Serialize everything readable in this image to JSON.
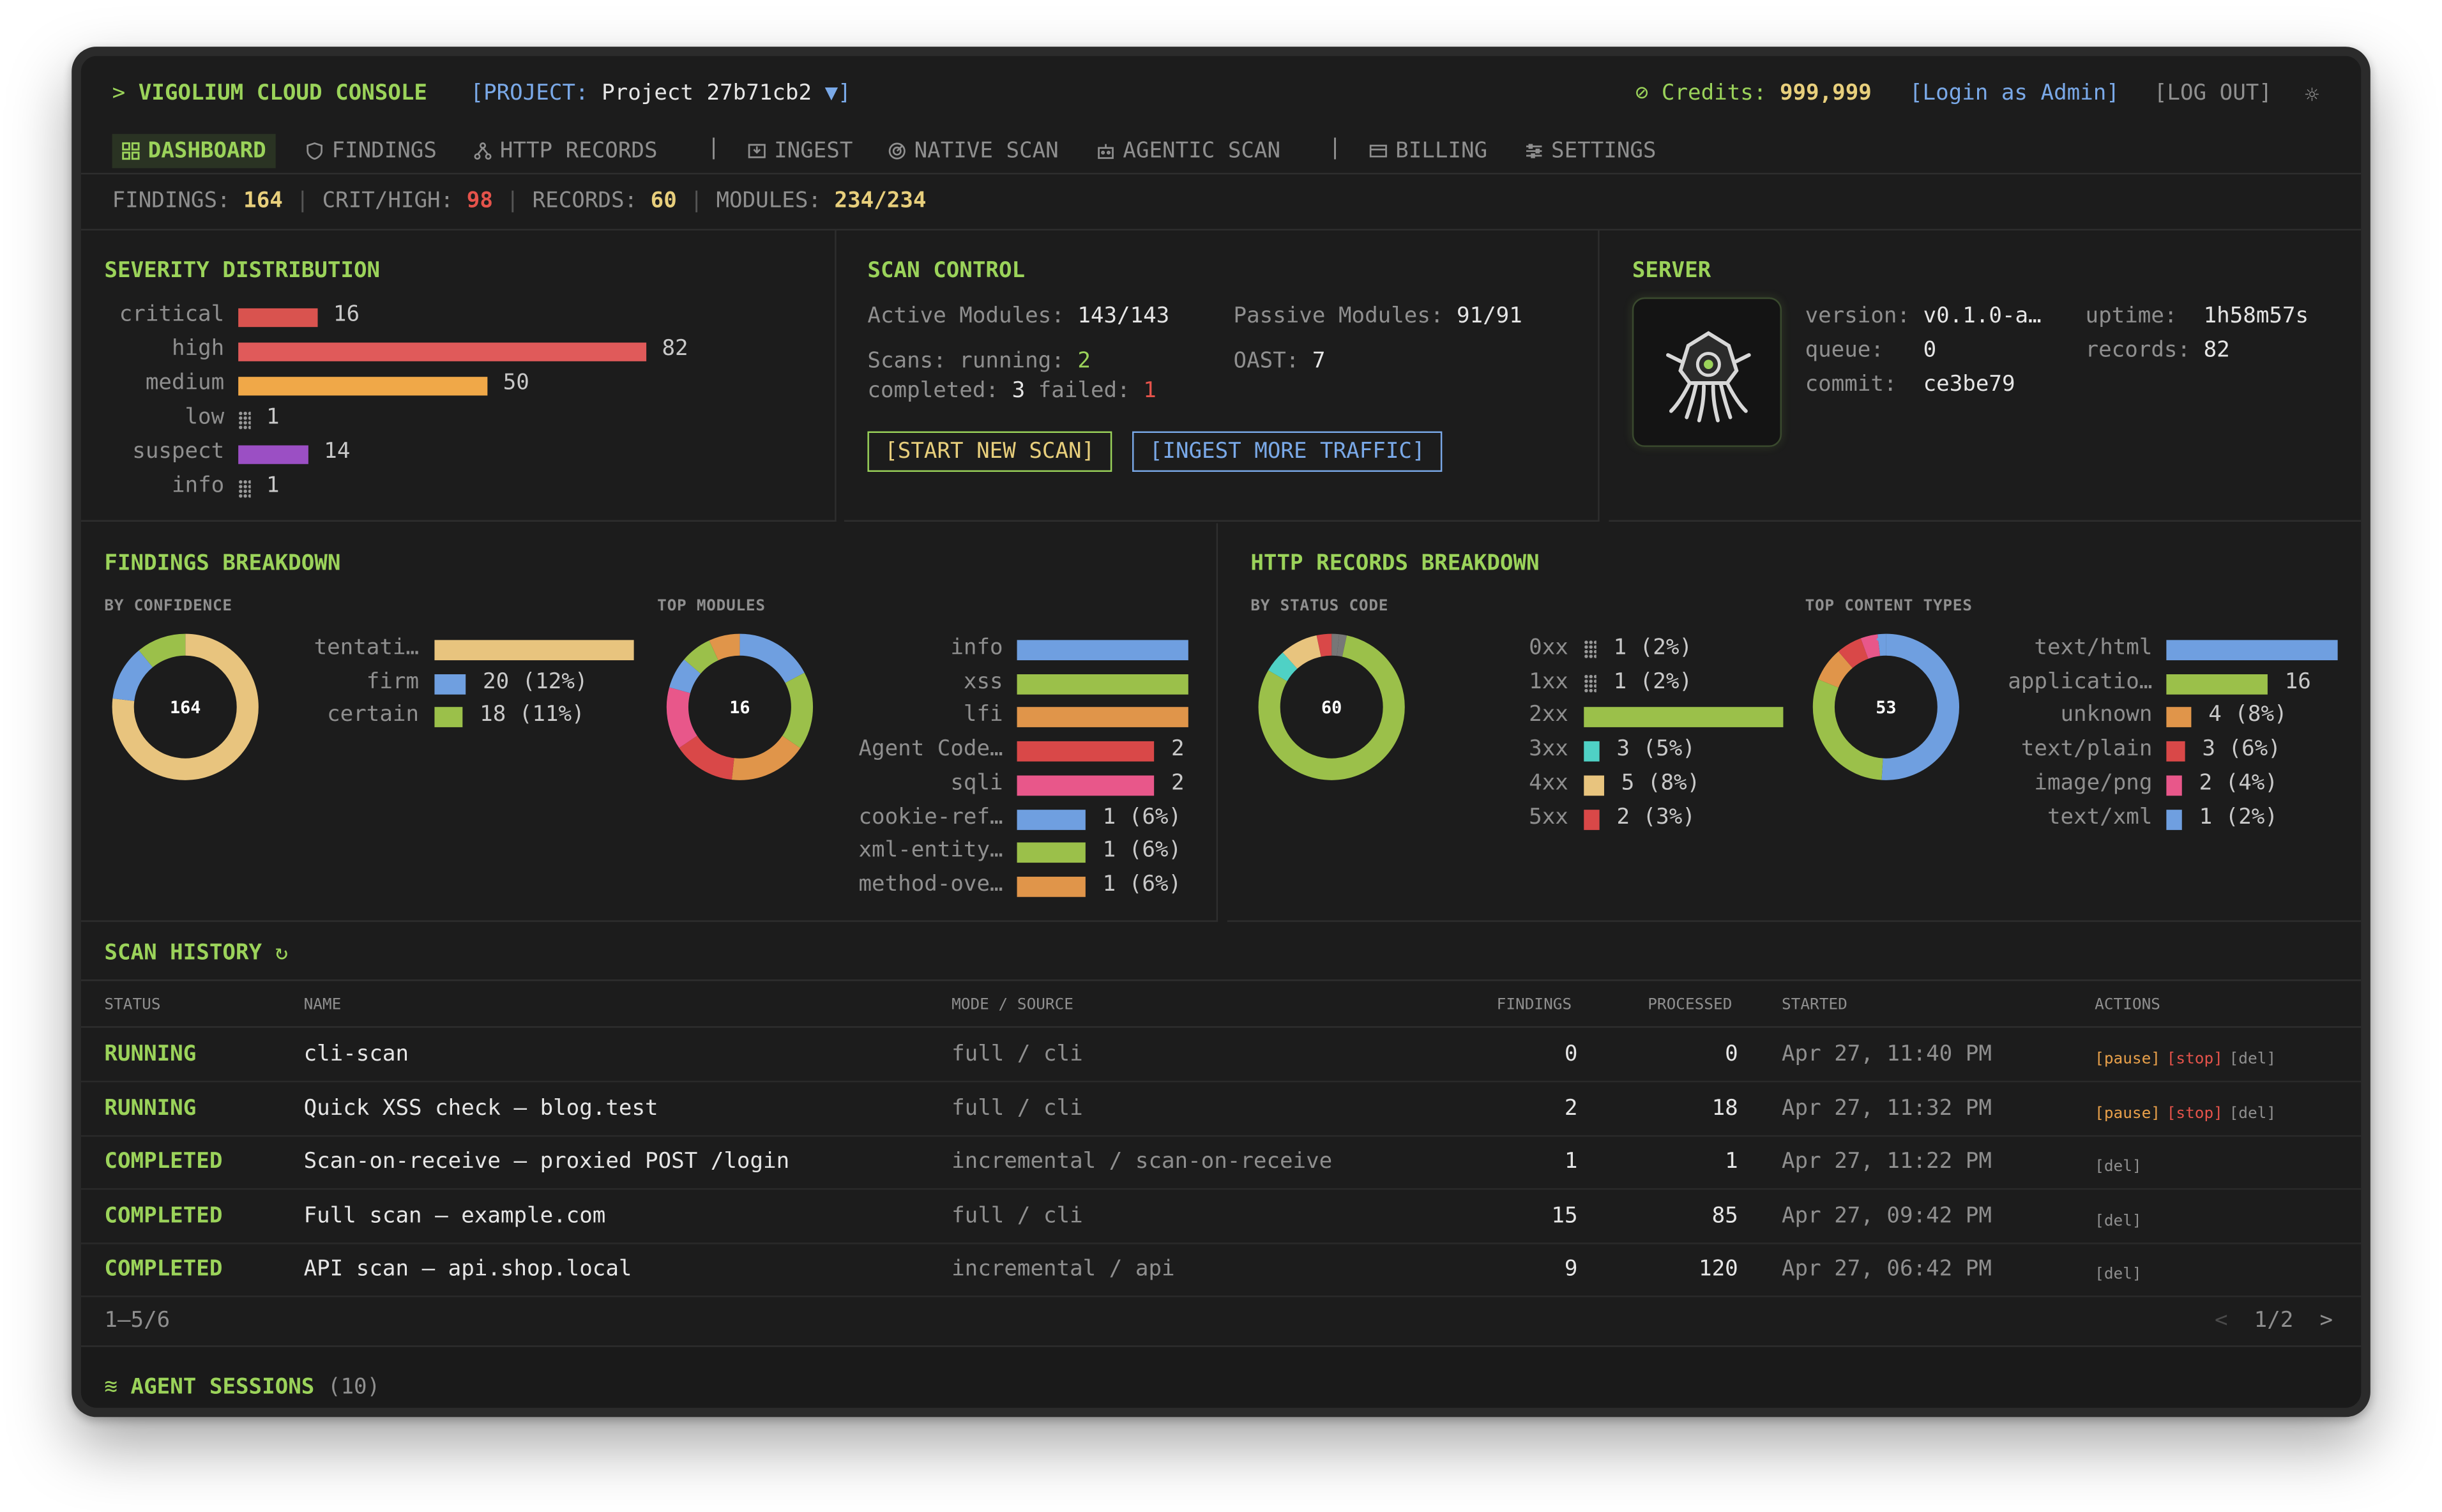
{
  "app": {
    "prompt": ">",
    "title": "VIGOLIUM CLOUD CONSOLE",
    "project_label": "[PROJECT:",
    "project_name": "Project 27b71cb2",
    "project_caret": "▼]",
    "credits_label": "Credits:",
    "credits_value": "999,999",
    "login": "[Login as Admin]",
    "logout": "[LOG OUT]"
  },
  "nav": {
    "dashboard": "DASHBOARD",
    "findings": "FINDINGS",
    "http_records": "HTTP RECORDS",
    "ingest": "INGEST",
    "native_scan": "NATIVE SCAN",
    "agentic_scan": "AGENTIC SCAN",
    "billing": "BILLING",
    "settings": "SETTINGS"
  },
  "stats": {
    "findings_label": "FINDINGS:",
    "findings": "164",
    "crit_label": "CRIT/HIGH:",
    "crit": "98",
    "records_label": "RECORDS:",
    "records": "60",
    "modules_label": "MODULES:",
    "modules": "234/234",
    "sep": "|"
  },
  "severity": {
    "title": "SEVERITY DISTRIBUTION",
    "max": 82,
    "rows": [
      {
        "label": "critical",
        "value": 16,
        "color": "#d9534f"
      },
      {
        "label": "high",
        "value": 82,
        "color": "#e05a5a"
      },
      {
        "label": "medium",
        "value": 50,
        "color": "#f0a848"
      },
      {
        "label": "low",
        "value": 1,
        "color": "dots"
      },
      {
        "label": "suspect",
        "value": 14,
        "color": "#9b4fc4"
      },
      {
        "label": "info",
        "value": 1,
        "color": "dots"
      }
    ]
  },
  "scan_control": {
    "title": "SCAN CONTROL",
    "active_label": "Active Modules:",
    "active": "143/143",
    "passive_label": "Passive Modules:",
    "passive": "91/91",
    "scans_label": "Scans: running:",
    "running": "2",
    "oast_label": "OAST:",
    "oast": "7",
    "completed_label": "completed:",
    "completed": "3",
    "failed_label": "failed:",
    "failed": "1",
    "start_btn": "[START NEW SCAN]",
    "ingest_btn": "[INGEST MORE TRAFFIC]"
  },
  "server": {
    "title": "SERVER",
    "version_label": "version:",
    "version": "v0.1.0-a…",
    "queue_label": "queue:",
    "queue": "0",
    "commit_label": "commit:",
    "commit": "ce3be79",
    "uptime_label": "uptime:",
    "uptime": "1h58m57s",
    "records_label": "records:",
    "records": "82"
  },
  "findings_breakdown": {
    "title": "FINDINGS BREAKDOWN",
    "by_conf": "BY CONFIDENCE",
    "top_modules": "TOP MODULES",
    "confidence": {
      "total": "164",
      "rows": [
        {
          "label": "tentati…",
          "value": 126,
          "text": "",
          "color": "#e8c47e"
        },
        {
          "label": "firm",
          "value": 20,
          "text": "20 (12%)",
          "color": "#6f9fe0"
        },
        {
          "label": "certain",
          "value": 18,
          "text": "18 (11%)",
          "color": "#9bc04a"
        }
      ]
    },
    "modules": {
      "total": "16",
      "rows": [
        {
          "label": "info",
          "value": 5,
          "text": "",
          "color": "#6f9fe0"
        },
        {
          "label": "xss",
          "value": 5,
          "text": "",
          "color": "#9bc04a"
        },
        {
          "label": "lfi",
          "value": 5,
          "text": "",
          "color": "#e0954a"
        },
        {
          "label": "Agent Code…",
          "value": 4,
          "text": "2",
          "color": "#d94848"
        },
        {
          "label": "sqli",
          "value": 4,
          "text": "2",
          "color": "#e8578a"
        },
        {
          "label": "cookie-ref…",
          "value": 2,
          "text": "1 (6%)",
          "color": "#6f9fe0"
        },
        {
          "label": "xml-entity…",
          "value": 2,
          "text": "1 (6%)",
          "color": "#9bc04a"
        },
        {
          "label": "method-ove…",
          "value": 2,
          "text": "1 (6%)",
          "color": "#e0954a"
        }
      ]
    }
  },
  "http_breakdown": {
    "title": "HTTP RECORDS BREAKDOWN",
    "by_status": "BY STATUS CODE",
    "top_types": "TOP CONTENT TYPES",
    "status": {
      "total": "60",
      "rows": [
        {
          "label": "0xx",
          "value": 1,
          "text": "1 (2%)",
          "color": "dots"
        },
        {
          "label": "1xx",
          "value": 1,
          "text": "1 (2%)",
          "color": "dots"
        },
        {
          "label": "2xx",
          "value": 48,
          "text": "",
          "color": "#9bc04a"
        },
        {
          "label": "3xx",
          "value": 3,
          "text": "3 (5%)",
          "color": "#4fd1c5"
        },
        {
          "label": "4xx",
          "value": 5,
          "text": "5 (8%)",
          "color": "#e8c47e"
        },
        {
          "label": "5xx",
          "value": 2,
          "text": "2 (3%)",
          "color": "#d94848"
        }
      ]
    },
    "types": {
      "total": "53",
      "rows": [
        {
          "label": "text/html",
          "value": 27,
          "text": "",
          "color": "#6f9fe0"
        },
        {
          "label": "applicatio…",
          "value": 16,
          "text": "16",
          "color": "#9bc04a"
        },
        {
          "label": "unknown",
          "value": 4,
          "text": "4 (8%)",
          "color": "#e0954a"
        },
        {
          "label": "text/plain",
          "value": 3,
          "text": "3 (6%)",
          "color": "#d94848"
        },
        {
          "label": "image/png",
          "value": 2,
          "text": "2 (4%)",
          "color": "#e8578a"
        },
        {
          "label": "text/xml",
          "value": 1,
          "text": "1 (2%)",
          "color": "#6f9fe0"
        }
      ]
    }
  },
  "history": {
    "title": "SCAN HISTORY",
    "cols": {
      "status": "STATUS",
      "name": "NAME",
      "mode": "MODE / SOURCE",
      "findings": "FINDINGS",
      "processed": "PROCESSED",
      "started": "STARTED",
      "actions": "ACTIONS"
    },
    "rows": [
      {
        "status": "RUNNING",
        "name": "cli-scan",
        "mode": "full / cli",
        "findings": "0",
        "processed": "0",
        "started": "Apr 27, 11:40 PM",
        "actions": [
          "[pause]",
          "[stop]",
          "[del]"
        ]
      },
      {
        "status": "RUNNING",
        "name": "Quick XSS check — blog.test",
        "mode": "full / cli",
        "findings": "2",
        "processed": "18",
        "started": "Apr 27, 11:32 PM",
        "actions": [
          "[pause]",
          "[stop]",
          "[del]"
        ]
      },
      {
        "status": "COMPLETED",
        "name": "Scan-on-receive — proxied POST /login",
        "mode": "incremental / scan-on-receive",
        "findings": "1",
        "processed": "1",
        "started": "Apr 27, 11:22 PM",
        "actions": [
          "[del]"
        ]
      },
      {
        "status": "COMPLETED",
        "name": "Full scan — example.com",
        "mode": "full / cli",
        "findings": "15",
        "processed": "85",
        "started": "Apr 27, 09:42 PM",
        "actions": [
          "[del]"
        ]
      },
      {
        "status": "COMPLETED",
        "name": "API scan — api.shop.local",
        "mode": "incremental / api",
        "findings": "9",
        "processed": "120",
        "started": "Apr 27, 06:42 PM",
        "actions": [
          "[del]"
        ]
      }
    ],
    "range": "1–5/6",
    "page": "1/2",
    "prev": "<",
    "next": ">"
  },
  "agents": {
    "title": "AGENT SESSIONS",
    "count": "(10)"
  }
}
